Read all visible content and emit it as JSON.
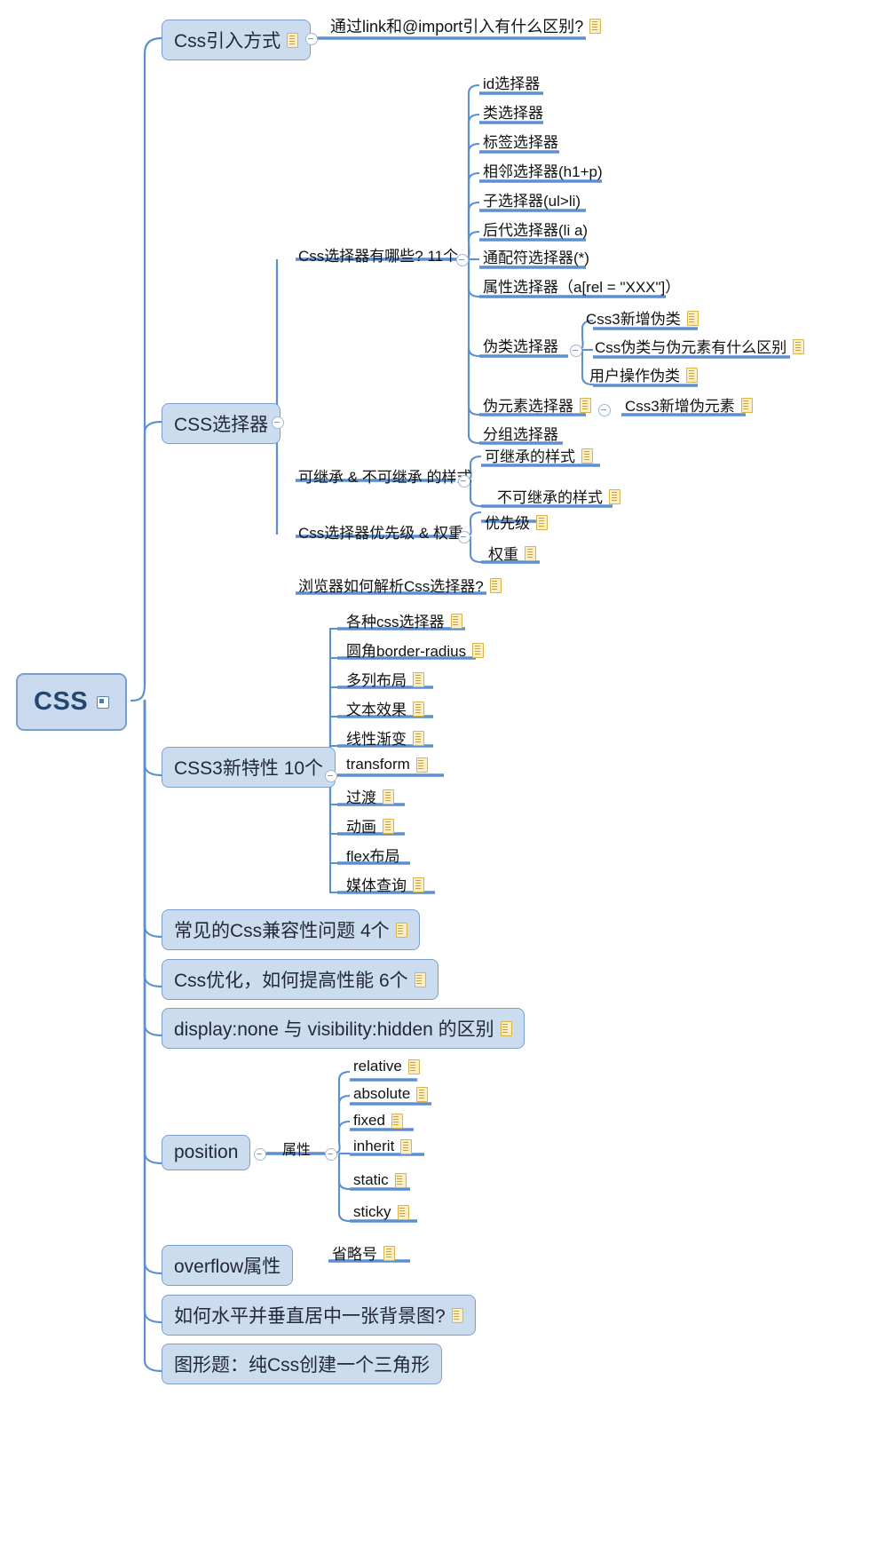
{
  "title": "CSS",
  "colors": {
    "branch": "#5b8fd0",
    "node_fill": "#ccdcef",
    "node_border": "#7a9fce",
    "root_fill": "#c9d9ee",
    "note_fill": "#fbeec4",
    "note_border": "#d9b44a",
    "text": "#1a1a1a"
  },
  "root": {
    "label": "CSS",
    "icon": "collapse-box-icon"
  },
  "branches": [
    {
      "label": "Css引入方式",
      "has_note": true,
      "children": [
        {
          "label": "通过link和@import引入有什么区别?",
          "has_note": true
        }
      ]
    },
    {
      "label": "CSS选择器",
      "has_note": false,
      "children": [
        {
          "label": "Css选择器有哪些? 11个",
          "has_note": false,
          "children": [
            {
              "label": "id选择器",
              "has_note": false
            },
            {
              "label": "类选择器",
              "has_note": false
            },
            {
              "label": "标签选择器",
              "has_note": false
            },
            {
              "label": "相邻选择器(h1+p)",
              "has_note": false
            },
            {
              "label": "子选择器(ul>li)",
              "has_note": false
            },
            {
              "label": "后代选择器(li a)",
              "has_note": false
            },
            {
              "label": "通配符选择器(*)",
              "has_note": false
            },
            {
              "label": "属性选择器（a[rel = \"XXX\"]）",
              "has_note": false
            },
            {
              "label": "伪类选择器",
              "has_note": false,
              "children": [
                {
                  "label": "Css3新增伪类",
                  "has_note": true
                },
                {
                  "label": "Css伪类与伪元素有什么区别",
                  "has_note": true
                },
                {
                  "label": "用户操作伪类",
                  "has_note": true
                }
              ]
            },
            {
              "label": "伪元素选择器",
              "has_note": true,
              "children": [
                {
                  "label": "Css3新增伪元素",
                  "has_note": true
                }
              ]
            },
            {
              "label": "分组选择器",
              "has_note": false
            }
          ]
        },
        {
          "label": "可继承 & 不可继承 的样式",
          "has_note": false,
          "children": [
            {
              "label": "可继承的样式",
              "has_note": true
            },
            {
              "label": "不可继承的样式",
              "has_note": true
            }
          ]
        },
        {
          "label": "Css选择器优先级 & 权重",
          "has_note": false,
          "children": [
            {
              "label": "优先级",
              "has_note": true
            },
            {
              "label": "权重",
              "has_note": true
            }
          ]
        },
        {
          "label": "浏览器如何解析Css选择器?",
          "has_note": true
        }
      ]
    },
    {
      "label": "CSS3新特性 10个",
      "has_note": false,
      "children": [
        {
          "label": "各种css选择器",
          "has_note": true
        },
        {
          "label": "圆角border-radius",
          "has_note": true
        },
        {
          "label": "多列布局",
          "has_note": true
        },
        {
          "label": "文本效果",
          "has_note": true
        },
        {
          "label": "线性渐变",
          "has_note": true
        },
        {
          "label": "transform",
          "has_note": true
        },
        {
          "label": "过渡",
          "has_note": true
        },
        {
          "label": "动画",
          "has_note": true
        },
        {
          "label": "flex布局",
          "has_note": false
        },
        {
          "label": "媒体查询",
          "has_note": true
        }
      ]
    },
    {
      "label": "常见的Css兼容性问题  4个",
      "has_note": true,
      "children": []
    },
    {
      "label": "Css优化，如何提高性能 6个",
      "has_note": true,
      "children": []
    },
    {
      "label": "display:none 与 visibility:hidden 的区别",
      "has_note": true,
      "children": []
    },
    {
      "label": "position",
      "has_note": false,
      "children": [
        {
          "label": "属性",
          "has_note": false,
          "children": [
            {
              "label": "relative",
              "has_note": true
            },
            {
              "label": "absolute",
              "has_note": true
            },
            {
              "label": "fixed",
              "has_note": true
            },
            {
              "label": "inherit",
              "has_note": true
            },
            {
              "label": "static",
              "has_note": true
            },
            {
              "label": "sticky",
              "has_note": true
            }
          ]
        }
      ]
    },
    {
      "label": "overflow属性",
      "has_note": false,
      "children": [
        {
          "label": "省略号",
          "has_note": true
        }
      ]
    },
    {
      "label": "如何水平并垂直居中一张背景图?",
      "has_note": true,
      "children": []
    },
    {
      "label": "图形题：纯Css创建一个三角形",
      "has_note": false,
      "children": []
    }
  ]
}
